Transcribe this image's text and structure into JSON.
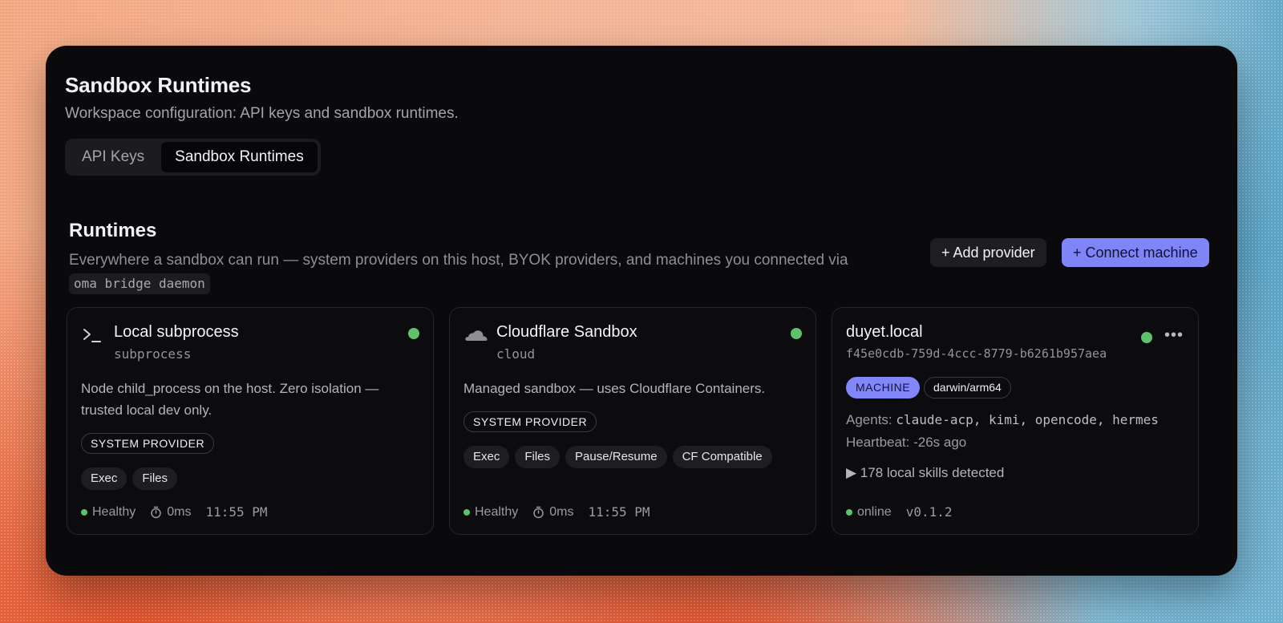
{
  "header": {
    "title": "Sandbox Runtimes",
    "subtitle": "Workspace configuration: API keys and sandbox runtimes."
  },
  "tabs": [
    {
      "label": "API Keys",
      "active": false
    },
    {
      "label": "Sandbox Runtimes",
      "active": true
    }
  ],
  "section": {
    "title": "Runtimes",
    "description": "Everywhere a sandbox can run — system providers on this host, BYOK providers, and machines you connected via",
    "command": "oma bridge daemon",
    "add_provider_label": "+ Add provider",
    "connect_machine_label": "+ Connect machine"
  },
  "cards": [
    {
      "icon": "terminal-icon",
      "name": "Local subprocess",
      "kind": "subprocess",
      "description": "Node child_process on the host. Zero isolation — trusted local dev only.",
      "badge": "SYSTEM PROVIDER",
      "capabilities": [
        "Exec",
        "Files"
      ],
      "status": "Healthy",
      "latency": "0ms",
      "time": "11:55 PM"
    },
    {
      "icon": "cloud-icon",
      "name": "Cloudflare Sandbox",
      "kind": "cloud",
      "description": "Managed sandbox — uses Cloudflare Containers.",
      "badge": "SYSTEM PROVIDER",
      "capabilities": [
        "Exec",
        "Files",
        "Pause/Resume",
        "CF Compatible"
      ],
      "status": "Healthy",
      "latency": "0ms",
      "time": "11:55 PM"
    },
    {
      "name": "duyet.local",
      "id": "f45e0cdb-759d-4ccc-8779-b6261b957aea",
      "badge": "MACHINE",
      "platform": "darwin/arm64",
      "agents_label": "Agents:",
      "agents": "claude-acp, kimi, opencode, hermes",
      "heartbeat": "Heartbeat: -26s ago",
      "skills": "▶ 178 local skills detected",
      "status": "online",
      "version": "v0.1.2"
    }
  ],
  "colors": {
    "accent": "#7f84f7",
    "healthy": "#5ec26a",
    "window_bg": "#0a0a0c"
  }
}
